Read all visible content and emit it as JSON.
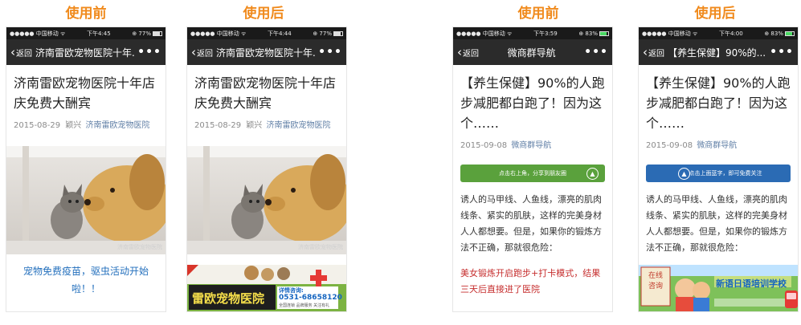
{
  "captions": [
    "使用前",
    "使用后",
    "使用前",
    "使用后"
  ],
  "phones": [
    {
      "status": {
        "carrier": "●●●●● 中国移动 ᯤ",
        "time": "下午4:45",
        "battery": "⊕ 77%"
      },
      "nav": {
        "back": "返回",
        "title": "济南雷欧宠物医院十年...",
        "more": "•••"
      },
      "article": {
        "title": "济南雷欧宠物医院十年店庆免费大酬宾",
        "date": "2015-08-29",
        "author": "颖兴",
        "account": "济南雷欧宠物医院"
      },
      "watermark": "济南雷欧宠物医院",
      "link": "宠物免费疫苗，驱虫活动开始啦！！"
    },
    {
      "status": {
        "carrier": "●●●●● 中国移动 ᯤ",
        "time": "下午4:44",
        "battery": "⊕ 77%"
      },
      "nav": {
        "back": "返回",
        "title": "济南雷欧宠物医院十年...",
        "more": "•••"
      },
      "article": {
        "title": "济南雷欧宠物医院十年店庆免费大酬宾",
        "date": "2015-08-29",
        "author": "颖兴",
        "account": "济南雷欧宠物医院"
      },
      "watermark": "济南雷欧宠物医院",
      "ad": {
        "brand": "雷欧宠物医院",
        "phone_label": "详情咨询:",
        "phone": "0531-68658120",
        "small": "全国连锁 品牌服务 关注有礼"
      }
    },
    {
      "status": {
        "carrier": "●●●●● 中国移动 ᯤ",
        "time": "下午3:59",
        "battery": "⊕ 83%"
      },
      "nav": {
        "back": "返回",
        "title": "微商群导航",
        "more": "•••"
      },
      "article": {
        "title": "【养生保健】90%的人跑步减肥都白跑了！因为这个……",
        "date": "2015-09-08",
        "account": "微商群导航"
      },
      "banner": "点击右上角，分享到朋友圈",
      "body": "诱人的马甲线、人鱼线，漂亮的肌肉线条、紧实的肌肤，这样的完美身材人人都想要。但是，如果你的锻炼方法不正确，那就很危险：",
      "red": "美女锻炼开启跑步+打卡模式，结果三天后直接进了医院"
    },
    {
      "status": {
        "carrier": "●●●●● 中国移动 ᯤ",
        "time": "下午4:00",
        "battery": "⊕ 83%"
      },
      "nav": {
        "back": "返回",
        "title": "【养生保健】90%的...",
        "more": "•••"
      },
      "article": {
        "title": "【养生保健】90%的人跑步减肥都白跑了！因为这个……",
        "date": "2015-09-08",
        "account": "微商群导航"
      },
      "banner": "点击上面蓝字，即可免费关注",
      "body": "诱人的马甲线、人鱼线，漂亮的肌肉线条、紧实的肌肤，这样的完美身材人人都想要。但是，如果你的锻炼方法不正确，那就很危险：",
      "ad": {
        "left": "在线咨询",
        "headline": "新语日语培训学校"
      }
    }
  ]
}
